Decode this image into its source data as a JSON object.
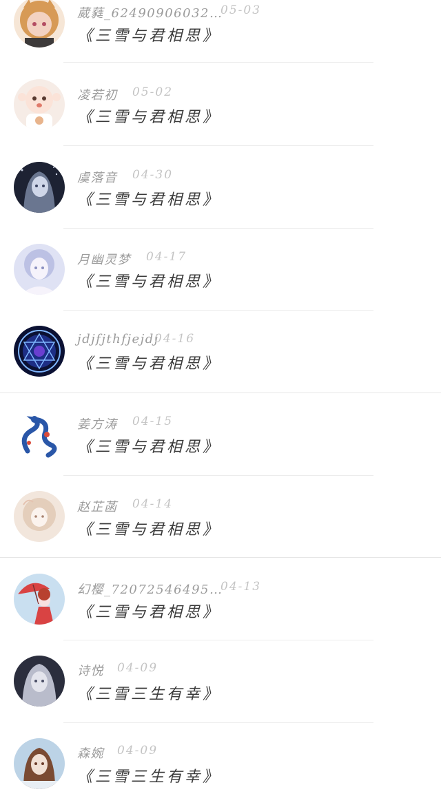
{
  "comments": [
    {
      "user": "葳蕤_62490906032…",
      "date": "05-03",
      "title": "《三雪与君相思》",
      "avatar_icon": "girl-orange-hair-avatar",
      "avatar_colors": [
        "#f6e6d6",
        "#d79a56",
        "#f3d2c2"
      ]
    },
    {
      "user": "凌若初",
      "date": "05-02",
      "title": "《三雪与君相思》",
      "avatar_icon": "cute-baby-avatar",
      "avatar_colors": [
        "#f6ece6",
        "#e8b48c",
        "#fbe3d8"
      ]
    },
    {
      "user": "虞落音",
      "date": "04-30",
      "title": "《三雪与君相思》",
      "avatar_icon": "anime-girl-night-avatar",
      "avatar_colors": [
        "#1d2233",
        "#6a7690",
        "#cfd6e8"
      ]
    },
    {
      "user": "月幽灵梦",
      "date": "04-17",
      "title": "《三雪与君相思》",
      "avatar_icon": "ethereal-girl-avatar",
      "avatar_colors": [
        "#dfe2f4",
        "#a5acd8",
        "#f6f3fb"
      ]
    },
    {
      "user": "jdjfjthfjejdj",
      "date": "04-16",
      "title": "《三雪与君相思》",
      "avatar_icon": "magic-circle-avatar",
      "avatar_colors": [
        "#0b1133",
        "#2f4bd8",
        "#7fb6ff"
      ]
    },
    {
      "user": "姜方涛",
      "date": "04-15",
      "title": "《三雪与君相思》",
      "avatar_icon": "blue-dragon-avatar",
      "avatar_colors": [
        "#ffffff",
        "#2a57a8",
        "#d94a3a"
      ]
    },
    {
      "user": "赵芷菡",
      "date": "04-14",
      "title": "《三雪与君相思》",
      "avatar_icon": "pastel-girl-avatar",
      "avatar_colors": [
        "#f2e6dc",
        "#d9b9a1",
        "#fbf3ee"
      ]
    },
    {
      "user": "幻樱_72072546495…",
      "date": "04-13",
      "title": "《三雪与君相思》",
      "avatar_icon": "red-umbrella-girl-avatar",
      "avatar_colors": [
        "#c9dff0",
        "#d94343",
        "#f7e0e0"
      ]
    },
    {
      "user": "诗悦",
      "date": "04-09",
      "title": "《三雪三生有幸》",
      "avatar_icon": "silver-hair-girl-avatar",
      "avatar_colors": [
        "#2b2e3d",
        "#b9bccb",
        "#e3e4ec"
      ]
    },
    {
      "user": "森婉",
      "date": "04-09",
      "title": "《三雪三生有幸》",
      "avatar_icon": "brown-hair-girl-avatar",
      "avatar_colors": [
        "#bcd3e6",
        "#7a4a32",
        "#f1e1d6"
      ]
    }
  ]
}
